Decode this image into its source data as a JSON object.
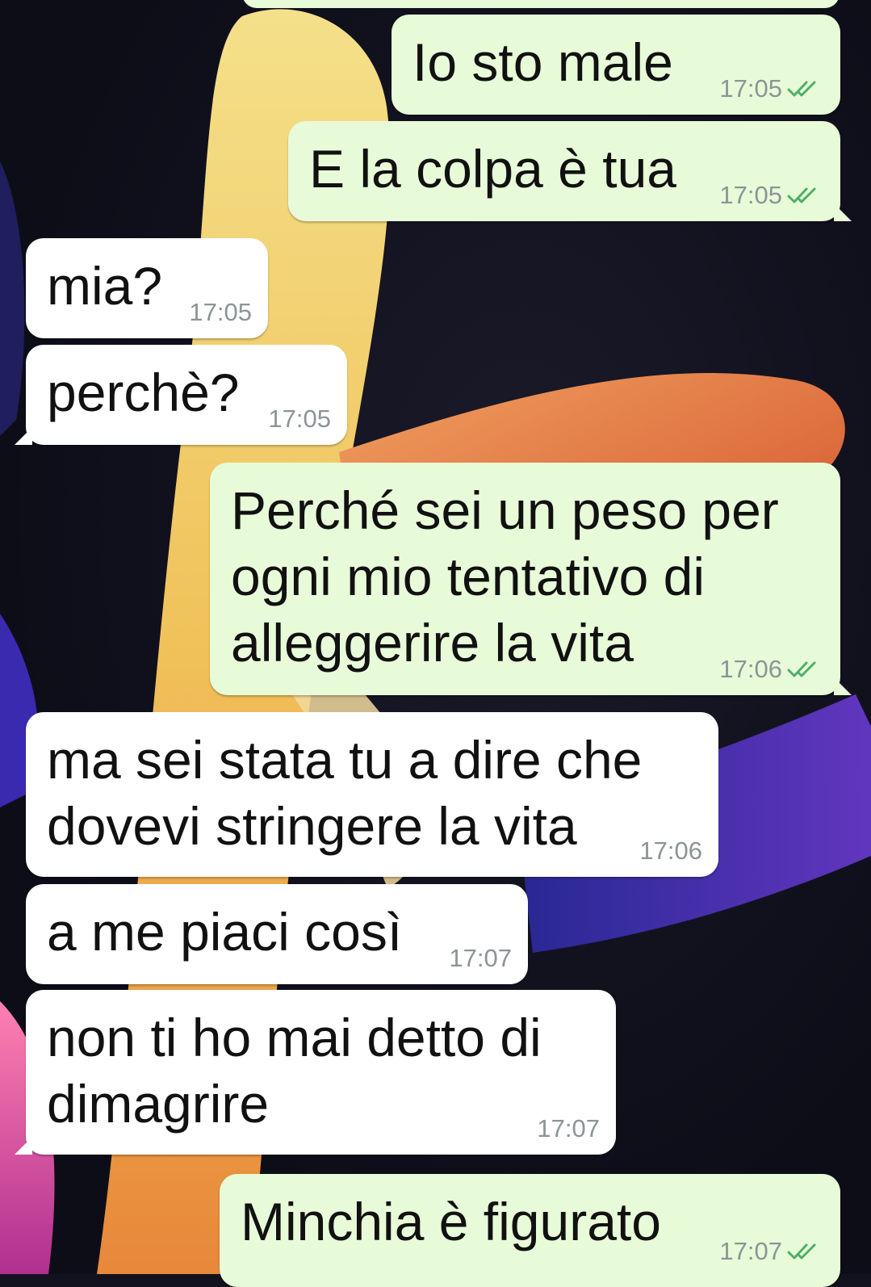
{
  "chat": {
    "messages": [
      {
        "direction": "out",
        "text": "Io sto male",
        "time": "17:05",
        "status_icon": "double-check-icon"
      },
      {
        "direction": "out",
        "text": "E la colpa è tua",
        "time": "17:05",
        "status_icon": "double-check-icon"
      },
      {
        "direction": "in",
        "text": "mia?",
        "time": "17:05"
      },
      {
        "direction": "in",
        "text": "perchè?",
        "time": "17:05"
      },
      {
        "direction": "out",
        "text": "Perché sei un peso per ogni mio tentativo di alleggerire la vita",
        "time": "17:06",
        "status_icon": "double-check-icon"
      },
      {
        "direction": "in",
        "text": "ma sei stata tu a dire che dovevi stringere la vita",
        "time": "17:06"
      },
      {
        "direction": "in",
        "text": "a me piaci così",
        "time": "17:07"
      },
      {
        "direction": "in",
        "text": "non ti ho mai detto di dimagrire",
        "time": "17:07"
      },
      {
        "direction": "out",
        "text": "Minchia è figurato",
        "time": "17:07",
        "status_icon": "double-check-icon"
      }
    ]
  },
  "colors": {
    "outgoing_bubble": "#e8fbd9",
    "incoming_bubble": "#ffffff",
    "timestamp": "#8c9496",
    "read_check": "#4fae6a"
  }
}
